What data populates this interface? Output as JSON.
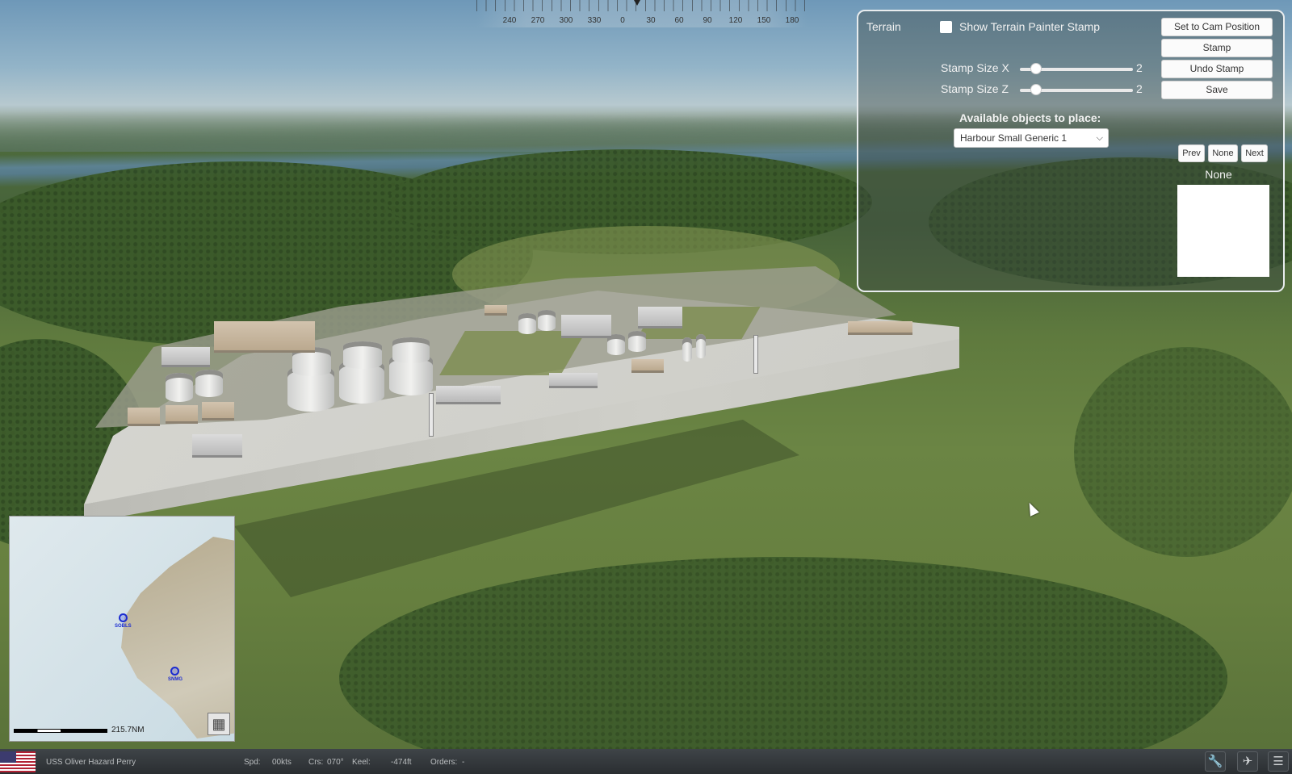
{
  "compass": {
    "labels": [
      "240",
      "270",
      "300",
      "330",
      "0",
      "30",
      "60",
      "90",
      "120",
      "150",
      "180"
    ]
  },
  "terrain_panel": {
    "title": "Terrain",
    "show_stamp_label": "Show Terrain Painter Stamp",
    "show_stamp_checked": false,
    "buttons": {
      "set_cam": "Set to Cam Position",
      "stamp": "Stamp",
      "undo_stamp": "Undo Stamp",
      "save": "Save",
      "prev": "Prev",
      "none": "None",
      "next": "Next"
    },
    "stamp_size_x": {
      "label": "Stamp Size X",
      "value": "2",
      "fraction": 0.1
    },
    "stamp_size_z": {
      "label": "Stamp Size Z",
      "value": "2",
      "fraction": 0.1
    },
    "available_label": "Available objects to place:",
    "selected_object": "Harbour Small Generic 1",
    "preview_label": "None"
  },
  "minimap": {
    "scale": "215.7NM",
    "markers": [
      {
        "label": "SOBLS"
      },
      {
        "label": "SNMG"
      }
    ],
    "grid_icon": "grid-icon"
  },
  "bottom_bar": {
    "unit_name": "USS Oliver Hazard Perry",
    "speed_label": "Spd:",
    "speed_value": "00kts",
    "course_label": "Crs:",
    "course_value": "070°",
    "keel_label": "Keel:",
    "keel_value": "-474ft",
    "orders_label": "Orders:",
    "orders_value": "-",
    "icons": [
      "wrench-icon",
      "aircraft-icon",
      "list-icon"
    ]
  }
}
